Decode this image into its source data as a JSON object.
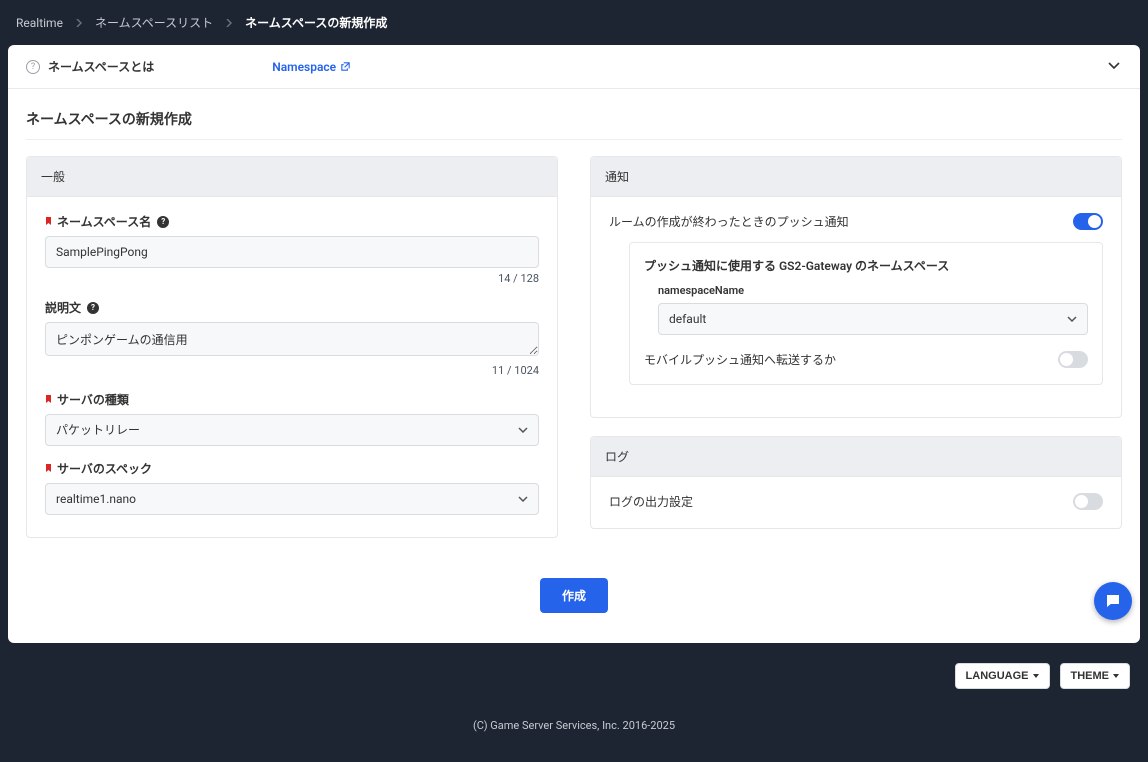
{
  "breadcrumb": {
    "root": "Realtime",
    "list": "ネームスペースリスト",
    "current": "ネームスペースの新規作成"
  },
  "info": {
    "label": "ネームスペースとは",
    "link": "Namespace"
  },
  "page_title": "ネームスペースの新規作成",
  "general": {
    "header": "一般",
    "name_label": "ネームスペース名",
    "name_value": "SamplePingPong",
    "name_counter": "14 / 128",
    "desc_label": "説明文",
    "desc_value": "ピンポンゲームの通信用",
    "desc_counter": "11 / 1024",
    "server_type_label": "サーバの種類",
    "server_type_value": "パケットリレー",
    "server_spec_label": "サーバのスペック",
    "server_spec_value": "realtime1.nano"
  },
  "notify": {
    "header": "通知",
    "room_push_label": "ルームの作成が終わったときのプッシュ通知",
    "room_push_on": true,
    "gateway_label": "プッシュ通知に使用する GS2-Gateway のネームスペース",
    "gateway_ns_label": "namespaceName",
    "gateway_ns_value": "default",
    "mobile_forward_label": "モバイルプッシュ通知へ転送するか"
  },
  "log": {
    "header": "ログ",
    "output_label": "ログの出力設定"
  },
  "submit_label": "作成",
  "footer": {
    "language": "LANGUAGE",
    "theme": "THEME"
  },
  "copyright": "(C) Game Server Services, Inc. 2016-2025"
}
